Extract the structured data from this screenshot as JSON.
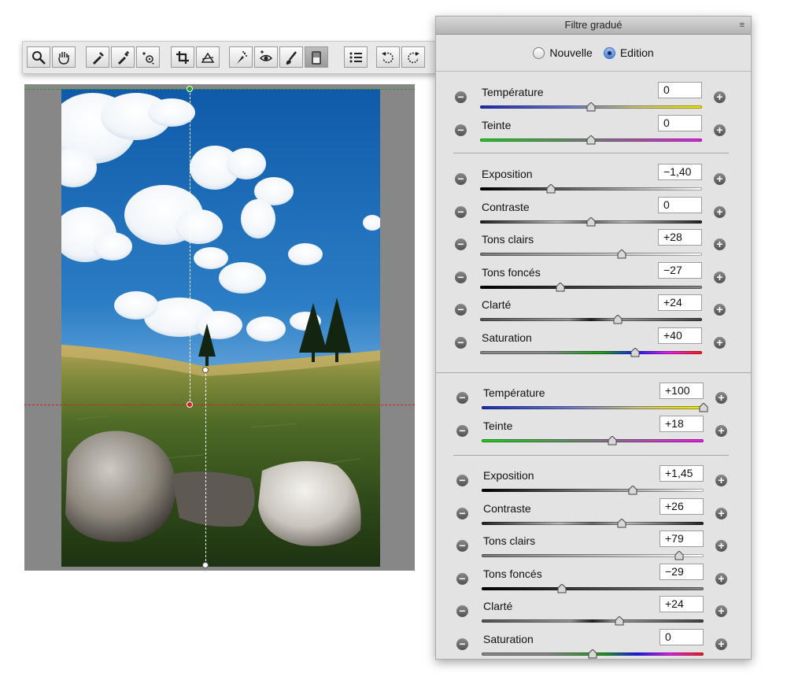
{
  "panel": {
    "title": "Filtre gradué",
    "menu_icon": "≡",
    "modes": [
      {
        "label": "Nouvelle",
        "selected": false
      },
      {
        "label": "Edition",
        "selected": true
      }
    ],
    "groups": [
      {
        "sliders": [
          {
            "label": "Température",
            "value": "0",
            "pos": 0.5,
            "track": "temp"
          },
          {
            "label": "Teinte",
            "value": "0",
            "pos": 0.5,
            "track": "tint"
          }
        ]
      },
      {
        "sliders": [
          {
            "label": "Exposition",
            "value": "−1,40",
            "pos": 0.32,
            "track": "exposure"
          },
          {
            "label": "Contraste",
            "value": "0",
            "pos": 0.5,
            "track": "contrast"
          },
          {
            "label": "Tons clairs",
            "value": "+28",
            "pos": 0.64,
            "track": "highlights"
          },
          {
            "label": "Tons foncés",
            "value": "−27",
            "pos": 0.36,
            "track": "shadows"
          },
          {
            "label": "Clarté",
            "value": "+24",
            "pos": 0.62,
            "track": "clarity"
          },
          {
            "label": "Saturation",
            "value": "+40",
            "pos": 0.7,
            "track": "saturation"
          }
        ]
      },
      {
        "sliders": [
          {
            "label": "Température",
            "value": "+100",
            "pos": 1.0,
            "track": "temp"
          },
          {
            "label": "Teinte",
            "value": "+18",
            "pos": 0.59,
            "track": "tint"
          }
        ]
      },
      {
        "sliders": [
          {
            "label": "Exposition",
            "value": "+1,45",
            "pos": 0.68,
            "track": "exposure"
          },
          {
            "label": "Contraste",
            "value": "+26",
            "pos": 0.63,
            "track": "contrast"
          },
          {
            "label": "Tons clairs",
            "value": "+79",
            "pos": 0.89,
            "track": "highlights"
          },
          {
            "label": "Tons foncés",
            "value": "−29",
            "pos": 0.36,
            "track": "shadows"
          },
          {
            "label": "Clarté",
            "value": "+24",
            "pos": 0.62,
            "track": "clarity"
          },
          {
            "label": "Saturation",
            "value": "0",
            "pos": 0.5,
            "track": "saturation"
          }
        ]
      }
    ]
  },
  "toolbar": {
    "groups": [
      [
        {
          "icon": "zoom-icon"
        },
        {
          "icon": "hand-icon"
        }
      ],
      [
        {
          "icon": "white-balance-icon"
        },
        {
          "icon": "color-sampler-icon"
        },
        {
          "icon": "targeted-adjustment-icon"
        }
      ],
      [
        {
          "icon": "crop-icon"
        },
        {
          "icon": "straighten-icon"
        }
      ],
      [
        {
          "icon": "spot-removal-icon"
        },
        {
          "icon": "red-eye-icon"
        },
        {
          "icon": "adjustment-brush-icon"
        },
        {
          "icon": "graduated-filter-icon",
          "active": true
        }
      ],
      [
        {
          "icon": "preferences-icon"
        }
      ],
      [
        {
          "icon": "rotate-left-icon"
        },
        {
          "icon": "rotate-right-icon"
        }
      ]
    ]
  },
  "colors": {
    "guide_green": "#2a9a2a",
    "guide_red": "#d02020",
    "guide_white": "#ffffff"
  }
}
